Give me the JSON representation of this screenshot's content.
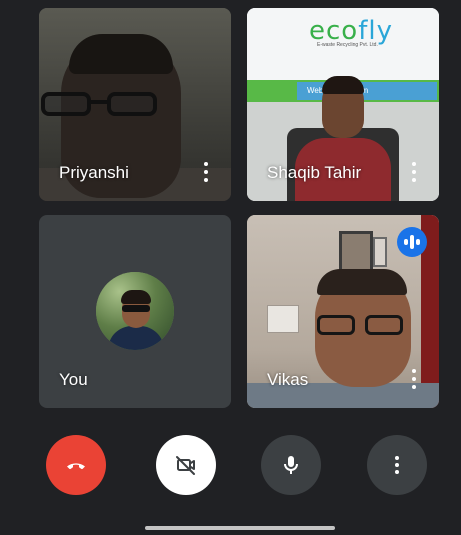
{
  "participants": [
    {
      "name": "Priyanshi"
    },
    {
      "name": "Shaqib Tahir",
      "background_sign": {
        "logo_e": "eco",
        "logo_fly": "fly",
        "tagline": "E-waste Recycling Pvt. Ltd.",
        "website": "Web          ewaste.com"
      }
    },
    {
      "name": "You"
    },
    {
      "name": "Vikas",
      "status": "speaking"
    }
  ],
  "controls": {
    "end_call": "end-call-icon",
    "camera": "camera-off-icon",
    "microphone": "mic-icon",
    "more": "more-vert-icon"
  },
  "colors": {
    "background": "#202124",
    "tile": "#3c4043",
    "end_call": "#ea4335",
    "speaking": "#1a73e8",
    "camera_button": "#ffffff"
  }
}
